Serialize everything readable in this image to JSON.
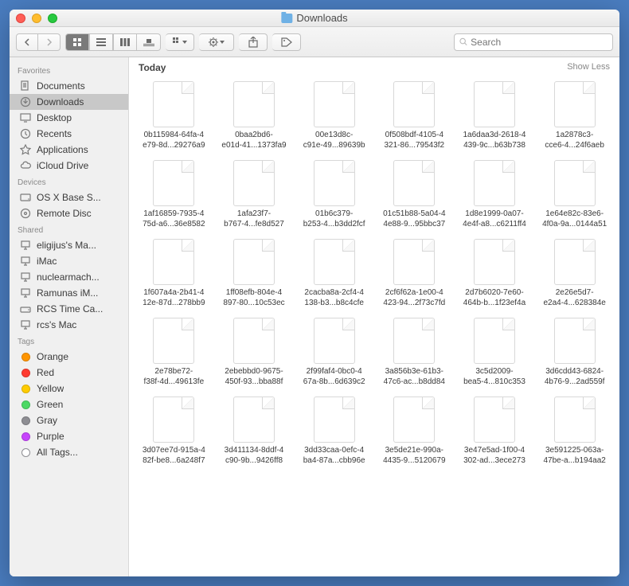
{
  "window": {
    "title": "Downloads"
  },
  "search": {
    "placeholder": "Search"
  },
  "sidebar": {
    "sections": [
      {
        "header": "Favorites",
        "items": [
          {
            "label": "Documents",
            "icon": "documents-icon",
            "selected": false
          },
          {
            "label": "Downloads",
            "icon": "downloads-icon",
            "selected": true
          },
          {
            "label": "Desktop",
            "icon": "desktop-icon",
            "selected": false
          },
          {
            "label": "Recents",
            "icon": "recents-icon",
            "selected": false
          },
          {
            "label": "Applications",
            "icon": "applications-icon",
            "selected": false
          },
          {
            "label": "iCloud Drive",
            "icon": "icloud-icon",
            "selected": false
          }
        ]
      },
      {
        "header": "Devices",
        "items": [
          {
            "label": "OS X Base S...",
            "icon": "disk-icon",
            "selected": false
          },
          {
            "label": "Remote Disc",
            "icon": "remote-disc-icon",
            "selected": false
          }
        ]
      },
      {
        "header": "Shared",
        "items": [
          {
            "label": "eligijus's Ma...",
            "icon": "mac-icon",
            "selected": false
          },
          {
            "label": "iMac",
            "icon": "imac-icon",
            "selected": false
          },
          {
            "label": "nuclearmach...",
            "icon": "mac-icon",
            "selected": false
          },
          {
            "label": "Ramunas iM...",
            "icon": "imac-icon",
            "selected": false
          },
          {
            "label": "RCS Time Ca...",
            "icon": "drive-icon",
            "selected": false
          },
          {
            "label": "rcs's Mac",
            "icon": "mac-icon",
            "selected": false
          }
        ]
      },
      {
        "header": "Tags",
        "items": [
          {
            "label": "Orange",
            "tag_color": "orange"
          },
          {
            "label": "Red",
            "tag_color": "red"
          },
          {
            "label": "Yellow",
            "tag_color": "yellow"
          },
          {
            "label": "Green",
            "tag_color": "green"
          },
          {
            "label": "Gray",
            "tag_color": "gray"
          },
          {
            "label": "Purple",
            "tag_color": "purple"
          },
          {
            "label": "All Tags...",
            "tag_color": "all"
          }
        ]
      }
    ]
  },
  "group": {
    "header": "Today",
    "toggle": "Show Less"
  },
  "files": [
    {
      "line1": "0b115984-64fa-4",
      "line2": "e79-8d...29276a9"
    },
    {
      "line1": "0baa2bd6-",
      "line2": "e01d-41...1373fa9"
    },
    {
      "line1": "00e13d8c-",
      "line2": "c91e-49...89639b"
    },
    {
      "line1": "0f508bdf-4105-4",
      "line2": "321-86...79543f2"
    },
    {
      "line1": "1a6daa3d-2618-4",
      "line2": "439-9c...b63b738"
    },
    {
      "line1": "1a2878c3-",
      "line2": "cce6-4...24f6aeb"
    },
    {
      "line1": "1af16859-7935-4",
      "line2": "75d-a6...36e8582"
    },
    {
      "line1": "1afa23f7-",
      "line2": "b767-4...fe8d527"
    },
    {
      "line1": "01b6c379-",
      "line2": "b253-4...b3dd2fcf"
    },
    {
      "line1": "01c51b88-5a04-4",
      "line2": "4e88-9...95bbc37"
    },
    {
      "line1": "1d8e1999-0a07-",
      "line2": "4e4f-a8...c6211ff4"
    },
    {
      "line1": "1e64e82c-83e6-",
      "line2": "4f0a-9a...0144a51"
    },
    {
      "line1": "1f607a4a-2b41-4",
      "line2": "12e-87d...278bb9"
    },
    {
      "line1": "1ff08efb-804e-4",
      "line2": "897-80...10c53ec"
    },
    {
      "line1": "2cacba8a-2cf4-4",
      "line2": "138-b3...b8c4cfe"
    },
    {
      "line1": "2cf6f62a-1e00-4",
      "line2": "423-94...2f73c7fd"
    },
    {
      "line1": "2d7b6020-7e60-",
      "line2": "464b-b...1f23ef4a"
    },
    {
      "line1": "2e26e5d7-",
      "line2": "e2a4-4...628384e"
    },
    {
      "line1": "2e78be72-",
      "line2": "f38f-4d...49613fe"
    },
    {
      "line1": "2ebebbd0-9675-",
      "line2": "450f-93...bba88f"
    },
    {
      "line1": "2f99faf4-0bc0-4",
      "line2": "67a-8b...6d639c2"
    },
    {
      "line1": "3a856b3e-61b3-",
      "line2": "47c6-ac...b8dd84"
    },
    {
      "line1": "3c5d2009-",
      "line2": "bea5-4...810c353"
    },
    {
      "line1": "3d6cdd43-6824-",
      "line2": "4b76-9...2ad559f"
    },
    {
      "line1": "3d07ee7d-915a-4",
      "line2": "82f-be8...6a248f7"
    },
    {
      "line1": "3d411134-8ddf-4",
      "line2": "c90-9b...9426ff8"
    },
    {
      "line1": "3dd33caa-0efc-4",
      "line2": "ba4-87a...cbb96e"
    },
    {
      "line1": "3e5de21e-990a-",
      "line2": "4435-9...5120679"
    },
    {
      "line1": "3e47e5ad-1f00-4",
      "line2": "302-ad...3ece273"
    },
    {
      "line1": "3e591225-063a-",
      "line2": "47be-a...b194aa2"
    }
  ]
}
